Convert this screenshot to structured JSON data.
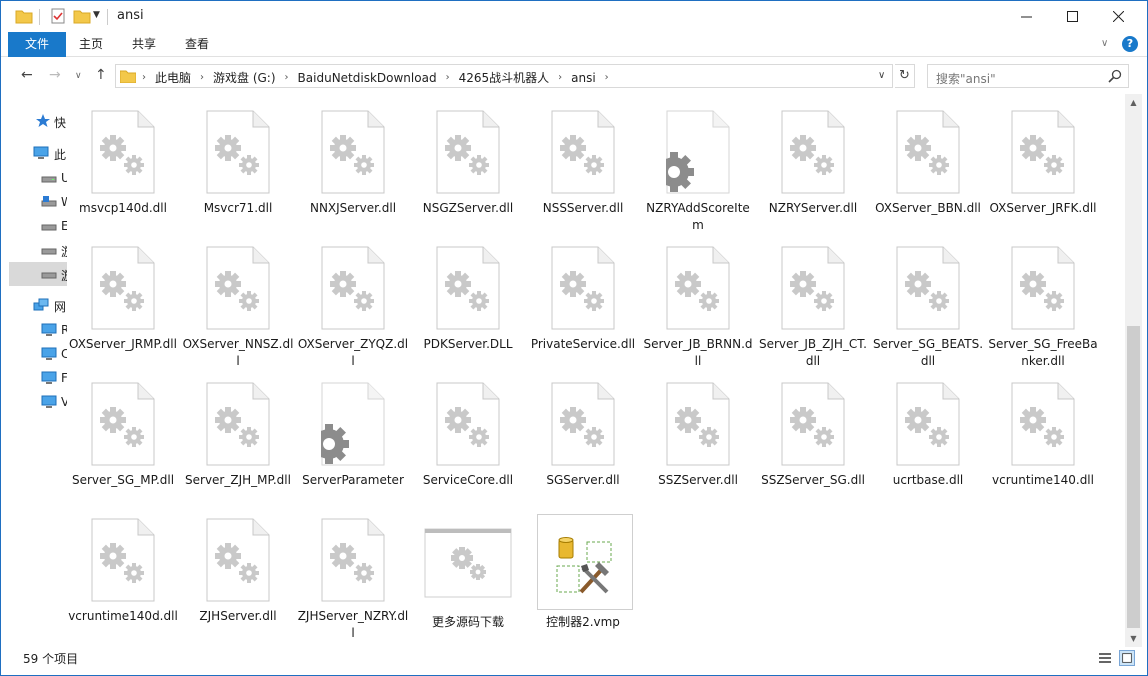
{
  "window": {
    "title": "ansi",
    "controls": {
      "minimize": "─",
      "maximize": "☐",
      "close": "✕"
    }
  },
  "ribbon": {
    "tabs": [
      "文件",
      "主页",
      "共享",
      "查看"
    ],
    "help": "?"
  },
  "address": {
    "crumbs": [
      "此电脑",
      "游戏盘 (G:)",
      "BaiduNetdiskDownload",
      "4265战斗机器人",
      "ansi"
    ],
    "search_placeholder": "搜索\"ansi\""
  },
  "navpane": {
    "items": [
      {
        "label": "快",
        "icon": "star-icon"
      },
      {
        "label": "此",
        "icon": "pc-icon"
      },
      {
        "label": "U",
        "icon": "drive-icon"
      },
      {
        "label": "W",
        "icon": "windows-drive-icon"
      },
      {
        "label": "E",
        "icon": "drive-icon"
      },
      {
        "label": "游",
        "icon": "drive-icon"
      },
      {
        "label": "游",
        "icon": "drive-icon",
        "selected": true
      },
      {
        "label": "网",
        "icon": "network-icon"
      },
      {
        "label": "R",
        "icon": "computer-icon"
      },
      {
        "label": "C",
        "icon": "computer-icon"
      },
      {
        "label": "F",
        "icon": "computer-icon"
      },
      {
        "label": "V",
        "icon": "computer-icon"
      }
    ]
  },
  "files": [
    {
      "name": "msvcp140d.dll",
      "type": "dll"
    },
    {
      "name": "Msvcr71.dll",
      "type": "dll"
    },
    {
      "name": "NNXJServer.dll",
      "type": "dll"
    },
    {
      "name": "NSGZServer.dll",
      "type": "dll"
    },
    {
      "name": "NSSServer.dll",
      "type": "dll"
    },
    {
      "name": "NZRYAddScoreItem",
      "type": "config"
    },
    {
      "name": "NZRYServer.dll",
      "type": "dll"
    },
    {
      "name": "OXServer_BBN.dll",
      "type": "dll"
    },
    {
      "name": "OXServer_JRFK.dll",
      "type": "dll"
    },
    {
      "name": "OXServer_JRMP.dll",
      "type": "dll"
    },
    {
      "name": "OXServer_NNSZ.dll",
      "type": "dll"
    },
    {
      "name": "OXServer_ZYQZ.dll",
      "type": "dll"
    },
    {
      "name": "PDKServer.DLL",
      "type": "dll"
    },
    {
      "name": "PrivateService.dll",
      "type": "dll"
    },
    {
      "name": "Server_JB_BRNN.dll",
      "type": "dll"
    },
    {
      "name": "Server_JB_ZJH_CT.dll",
      "type": "dll"
    },
    {
      "name": "Server_SG_BEATS.dll",
      "type": "dll"
    },
    {
      "name": "Server_SG_FreeBanker.dll",
      "type": "dll"
    },
    {
      "name": "Server_SG_MP.dll",
      "type": "dll"
    },
    {
      "name": "Server_ZJH_MP.dll",
      "type": "dll"
    },
    {
      "name": "ServerParameter",
      "type": "config"
    },
    {
      "name": "ServiceCore.dll",
      "type": "dll"
    },
    {
      "name": "SGServer.dll",
      "type": "dll"
    },
    {
      "name": "SSZServer.dll",
      "type": "dll"
    },
    {
      "name": "SSZServer_SG.dll",
      "type": "dll"
    },
    {
      "name": "ucrtbase.dll",
      "type": "dll"
    },
    {
      "name": "vcruntime140.dll",
      "type": "dll"
    },
    {
      "name": "vcruntime140d.dll",
      "type": "dll"
    },
    {
      "name": "ZJHServer.dll",
      "type": "dll"
    },
    {
      "name": "ZJHServer_NZRY.dll",
      "type": "dll"
    },
    {
      "name": "更多源码下载",
      "type": "shortcut"
    },
    {
      "name": "控制器2.vmp",
      "type": "vmp",
      "selected": true
    }
  ],
  "status": {
    "count": "59 个项目"
  }
}
